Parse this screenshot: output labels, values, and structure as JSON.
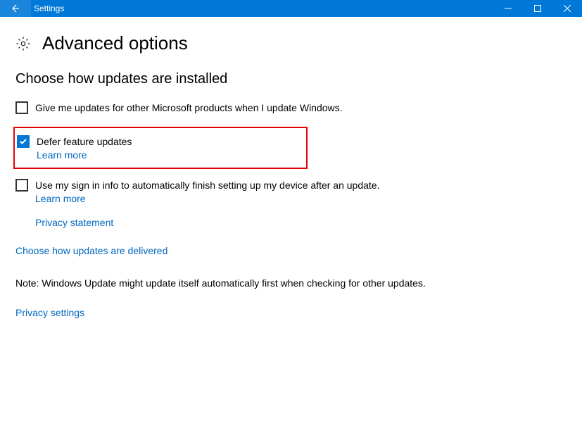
{
  "titlebar": {
    "title": "Settings"
  },
  "header": {
    "page_title": "Advanced options"
  },
  "section": {
    "title": "Choose how updates are installed"
  },
  "options": {
    "other_products": {
      "label": "Give me updates for other Microsoft products when I update Windows.",
      "checked": false
    },
    "defer": {
      "label": "Defer feature updates",
      "learn_more": "Learn more",
      "checked": true
    },
    "signin": {
      "label": "Use my sign in info to automatically finish setting up my device after an update.",
      "learn_more": "Learn more",
      "checked": false
    }
  },
  "links": {
    "privacy_statement": "Privacy statement",
    "delivered": "Choose how updates are delivered",
    "privacy_settings": "Privacy settings"
  },
  "note": "Note: Windows Update might update itself automatically first when checking for other updates."
}
